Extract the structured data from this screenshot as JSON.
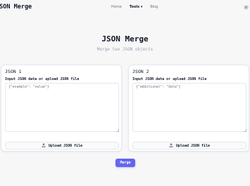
{
  "header": {
    "brand": "JSON Merge",
    "nav": [
      {
        "label": "Home"
      },
      {
        "label": "Tools ▾"
      },
      {
        "label": "Blog"
      }
    ],
    "settings_icon": "gear-icon"
  },
  "hero": {
    "title": "JSON Merge",
    "subtitle": "Merge two JSON objects"
  },
  "panels": [
    {
      "title": "JSON 1",
      "label": "Input JSON data or upload JSON file",
      "textarea_value": "{\"example\": \"value\"}",
      "upload_label": "Upload JSON file",
      "upload_icon": "upload-icon"
    },
    {
      "title": "JSON 2",
      "label": "Input JSON data or upload JSON file",
      "textarea_value": "{\"additional\": \"data\"}",
      "upload_label": "Upload JSON file",
      "upload_icon": "upload-icon"
    }
  ],
  "actions": {
    "merge_label": "Merge"
  },
  "colors": {
    "accent": "#6366f1",
    "background": "#f7f7f8"
  }
}
